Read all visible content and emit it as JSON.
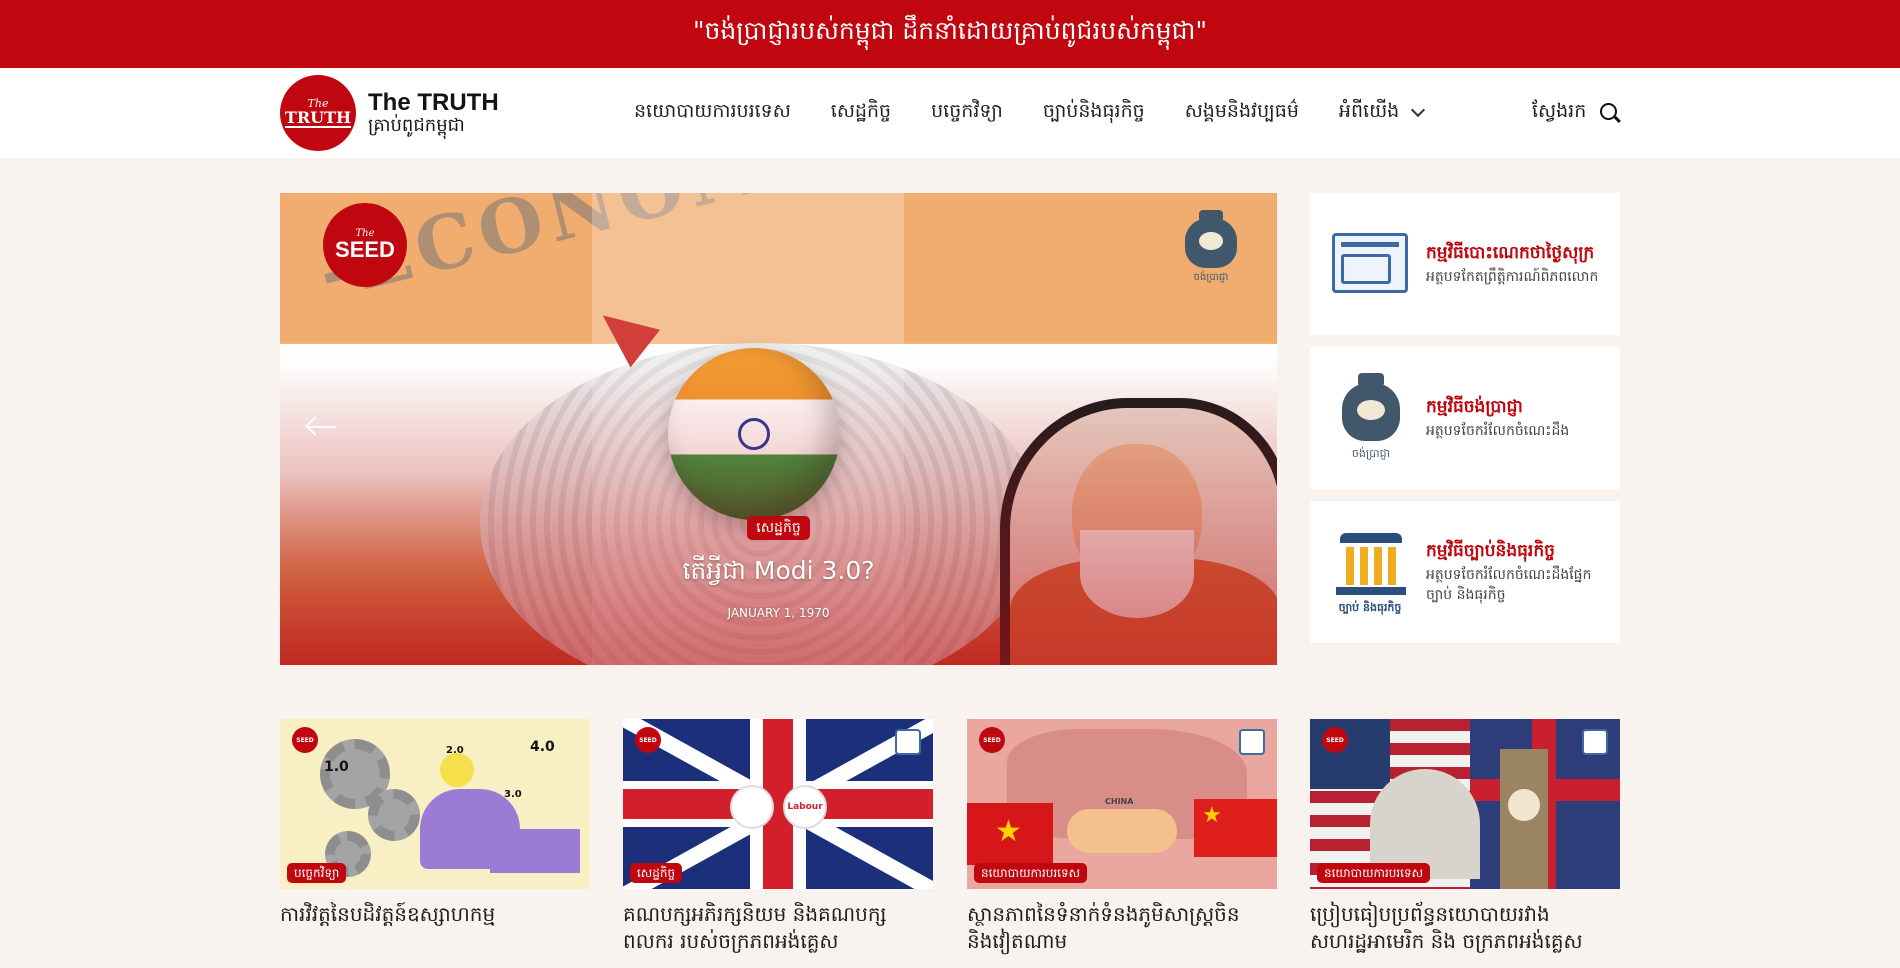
{
  "topbar": {
    "slogan": "\"ចង់ប្រាជ្ញារបស់កម្ពុជា ដឹកនាំដោយគ្រាប់ពូជរបស់កម្ពុជា\""
  },
  "brand": {
    "logo_small": "The",
    "logo_big": "TRUTH",
    "title": "The TRUTH",
    "subtitle": "គ្រាប់ពូជកម្ពុជា"
  },
  "nav": {
    "items": [
      {
        "label": "នយោបាយការបរទេស"
      },
      {
        "label": "សេដ្ឋកិច្ច"
      },
      {
        "label": "បច្ចេកវិទ្យា"
      },
      {
        "label": "ច្បាប់និងធុរកិច្ច"
      },
      {
        "label": "សង្គមនិងវប្បធម៌"
      },
      {
        "label": "អំពីយើង"
      }
    ],
    "search_label": "ស្វែងរក"
  },
  "hero": {
    "category": "សេដ្ឋកិច្ច",
    "title": "តើអ្វីជា Modi 3.0?",
    "date": "JANUARY 1, 1970",
    "bg_word": "-ECONOMY-",
    "seed_small": "The",
    "seed_big": "SEED",
    "brain_caption": "ចង់ប្រាជ្ញា"
  },
  "sidebar": {
    "cards": [
      {
        "title": "កម្មវិធីបោះណេកថាថ្ងៃសុក្រ",
        "desc": "អត្ថបទកែតព្រឹត្តិការណ៍ពិភពលោក",
        "icon": "book-icon"
      },
      {
        "title": "កម្មវិធីចង់ប្រាជ្ញា",
        "desc": "អត្ថបទចែករំលែកចំណេះដឹង",
        "icon": "brain-sack-icon",
        "icon_caption": "ចង់ប្រាជ្ញា"
      },
      {
        "title": "កម្មវិធីច្បាប់និងធុរកិច្ច",
        "desc": "អត្ថបទចែករំលែកចំណេះដឹងផ្នែកច្បាប់ និងធុរកិច្ច",
        "icon": "pillar-icon",
        "icon_caption": "ច្បាប់ និងធុរកិច្ច"
      }
    ]
  },
  "articles": [
    {
      "category": "បច្ចេកវិទ្យា",
      "title": "ការវិវត្តនៃបដិវត្តន៍ឧស្សាហកម្ម",
      "numbers": [
        "1.0",
        "2.0",
        "3.0",
        "4.0"
      ]
    },
    {
      "category": "សេដ្ឋកិច្ច",
      "title": "គណបក្សអភិរក្សនិយម និងគណបក្សពលករ របស់ចក្រភពអង់គ្លេស",
      "party_label": "Labour"
    },
    {
      "category": "នយោបាយការបរទេស",
      "title": "ស្ថានភាពនៃទំនាក់ទំនងភូមិសាស្ត្រចិន និងវៀតណាម",
      "map_label": "CHINA"
    },
    {
      "category": "នយោបាយការបរទេស",
      "title": "ប្រៀបធៀបប្រព័ន្ធនយោបាយរវាង សហរដ្ឋអាមេរិក និង ចក្រភពអង់គ្លេស"
    }
  ],
  "thumb_logo_text": "SEED",
  "colors": {
    "brand_red": "#c0070f",
    "page_bg": "#f8f3ee",
    "sidebar_title": "#c0070f"
  }
}
